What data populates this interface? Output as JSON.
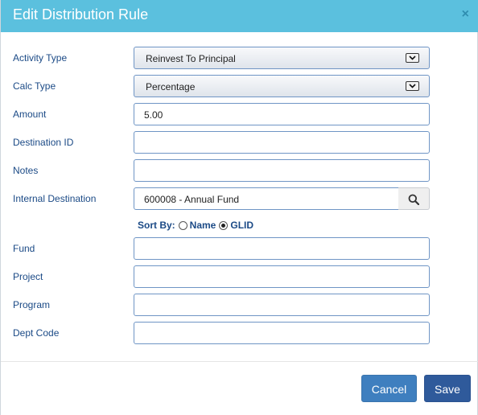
{
  "dialog": {
    "title": "Edit Distribution Rule",
    "close_symbol": "×"
  },
  "form": {
    "activity_type": {
      "label": "Activity Type",
      "value": "Reinvest To Principal"
    },
    "calc_type": {
      "label": "Calc Type",
      "value": "Percentage"
    },
    "amount": {
      "label": "Amount",
      "value": "5.00"
    },
    "destination_id": {
      "label": "Destination ID",
      "value": ""
    },
    "notes": {
      "label": "Notes",
      "value": ""
    },
    "internal_destination": {
      "label": "Internal Destination",
      "value": "600008 - Annual Fund"
    },
    "sort_by": {
      "label": "Sort By:",
      "options": [
        "Name",
        "GLID"
      ],
      "selected": "GLID"
    },
    "fund": {
      "label": "Fund",
      "value": ""
    },
    "project": {
      "label": "Project",
      "value": ""
    },
    "program": {
      "label": "Program",
      "value": ""
    },
    "dept_code": {
      "label": "Dept Code",
      "value": ""
    }
  },
  "footer": {
    "cancel_label": "Cancel",
    "save_label": "Save"
  },
  "colors": {
    "header": "#5bc0de",
    "label": "#1b4a86",
    "cancel": "#3f7fbf",
    "save": "#2f5a9b"
  },
  "icons": {
    "close": "close-icon",
    "dropdown": "chevron-down-icon",
    "search": "search-icon"
  }
}
